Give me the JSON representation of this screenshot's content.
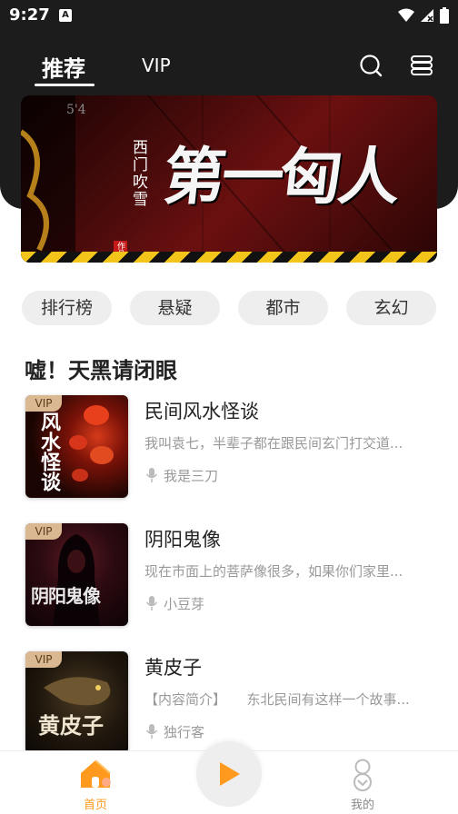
{
  "status_bar": {
    "time": "9:27",
    "notif_letter": "A"
  },
  "top_tabs": [
    {
      "label": "推荐",
      "active": true
    },
    {
      "label": "VIP",
      "active": false
    }
  ],
  "banner": {
    "author": "西门吹雪",
    "tag": "作品",
    "title": "第一匈人",
    "number_mark": "5'4"
  },
  "categories": [
    "排行榜",
    "悬疑",
    "都市",
    "玄幻"
  ],
  "section": {
    "title": "嘘！天黑请闭眼"
  },
  "items": [
    {
      "badge": "VIP",
      "title": "民间风水怪谈",
      "cover_text": "风水怪谈",
      "description": "我叫袁七，半辈子都在跟民间玄门打交道...",
      "author": "我是三刀"
    },
    {
      "badge": "VIP",
      "title": "阴阳鬼像",
      "cover_text": "阴阳鬼像",
      "description": "现在市面上的菩萨像很多，如果你们家里...",
      "author": "小豆芽"
    },
    {
      "badge": "VIP",
      "title": "黄皮子",
      "cover_text": "黄皮子",
      "description": "【内容简介】　　东北民间有这样一个故事...",
      "author": "独行客"
    }
  ],
  "bottom_nav": {
    "home_label": "首页",
    "mine_label": "我的"
  },
  "colors": {
    "header_bg": "#1c1c1c",
    "accent": "#ff9a1f",
    "chip_bg": "#eeeeee",
    "vip_badge": "#d9b892"
  }
}
